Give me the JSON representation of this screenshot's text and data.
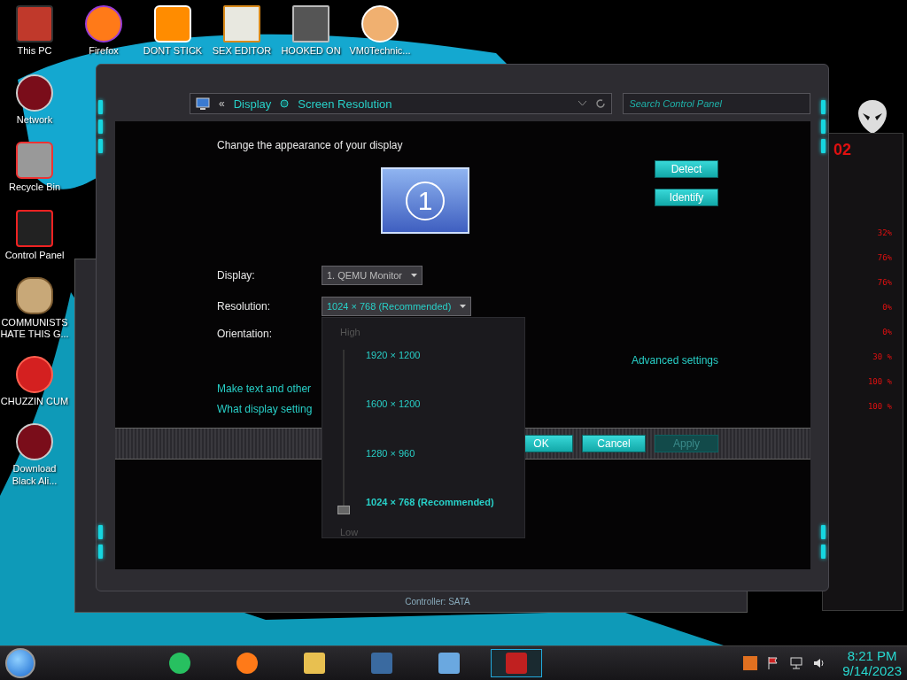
{
  "desktop_icons_top": [
    {
      "label": "This PC"
    },
    {
      "label": "Firefox"
    },
    {
      "label": "DONT STICK"
    },
    {
      "label": "SEX EDITOR"
    },
    {
      "label": "HOOKED ON"
    },
    {
      "label": "VM0Technic..."
    }
  ],
  "desktop_icons_left": [
    {
      "label": "Network"
    },
    {
      "label": "Recycle Bin"
    },
    {
      "label": "Control Panel"
    },
    {
      "label": "COMMUNISTS HATE THIS G..."
    },
    {
      "label": "CHUZZIN CUM"
    },
    {
      "label": "Download Black Ali..."
    }
  ],
  "background_window": {
    "text": "Controller: SATA"
  },
  "window": {
    "back_glyph": "«",
    "breadcrumb": [
      "Display",
      "Screen Resolution"
    ],
    "search": {
      "placeholder": "Search Control Panel"
    },
    "heading": "Change the appearance of your display",
    "monitor_number": "1",
    "side_buttons": [
      "Detect",
      "Identify"
    ],
    "fields": [
      {
        "kind": "select",
        "label": "Display:",
        "value": "1. QEMU Monitor",
        "open": false
      },
      {
        "kind": "select",
        "label": "Resolution:",
        "value": "1024 × 768 (Recommended)",
        "open": true
      },
      {
        "kind": "text",
        "label": "Orientation:"
      }
    ],
    "advanced_link": "Advanced settings",
    "links": [
      "Make text and other",
      "What display setting"
    ],
    "footer_buttons": [
      {
        "label": "OK",
        "disabled": false
      },
      {
        "label": "Cancel",
        "disabled": false
      },
      {
        "label": "Apply",
        "disabled": true
      }
    ],
    "resolution_popup": {
      "high_label": "High",
      "low_label": "Low",
      "options": [
        {
          "label": "1920 × 1200",
          "selected": false
        },
        {
          "label": "1600 × 1200",
          "selected": false
        },
        {
          "label": "1280 × 960",
          "selected": false
        },
        {
          "label": "1024 × 768 (Recommended)",
          "selected": true
        }
      ]
    }
  },
  "gadget": {
    "header": "02",
    "readings": [
      "32%",
      "76%",
      "76%",
      "0%",
      "0%",
      "30 %",
      "100 %",
      "100 %"
    ]
  },
  "taskbar": {
    "apps": [
      {
        "selected": false
      },
      {
        "selected": false
      },
      {
        "selected": false
      },
      {
        "selected": false
      },
      {
        "selected": false
      },
      {
        "selected": true
      }
    ],
    "clock": {
      "time": "8:21 PM",
      "date": "9/14/2023"
    }
  }
}
